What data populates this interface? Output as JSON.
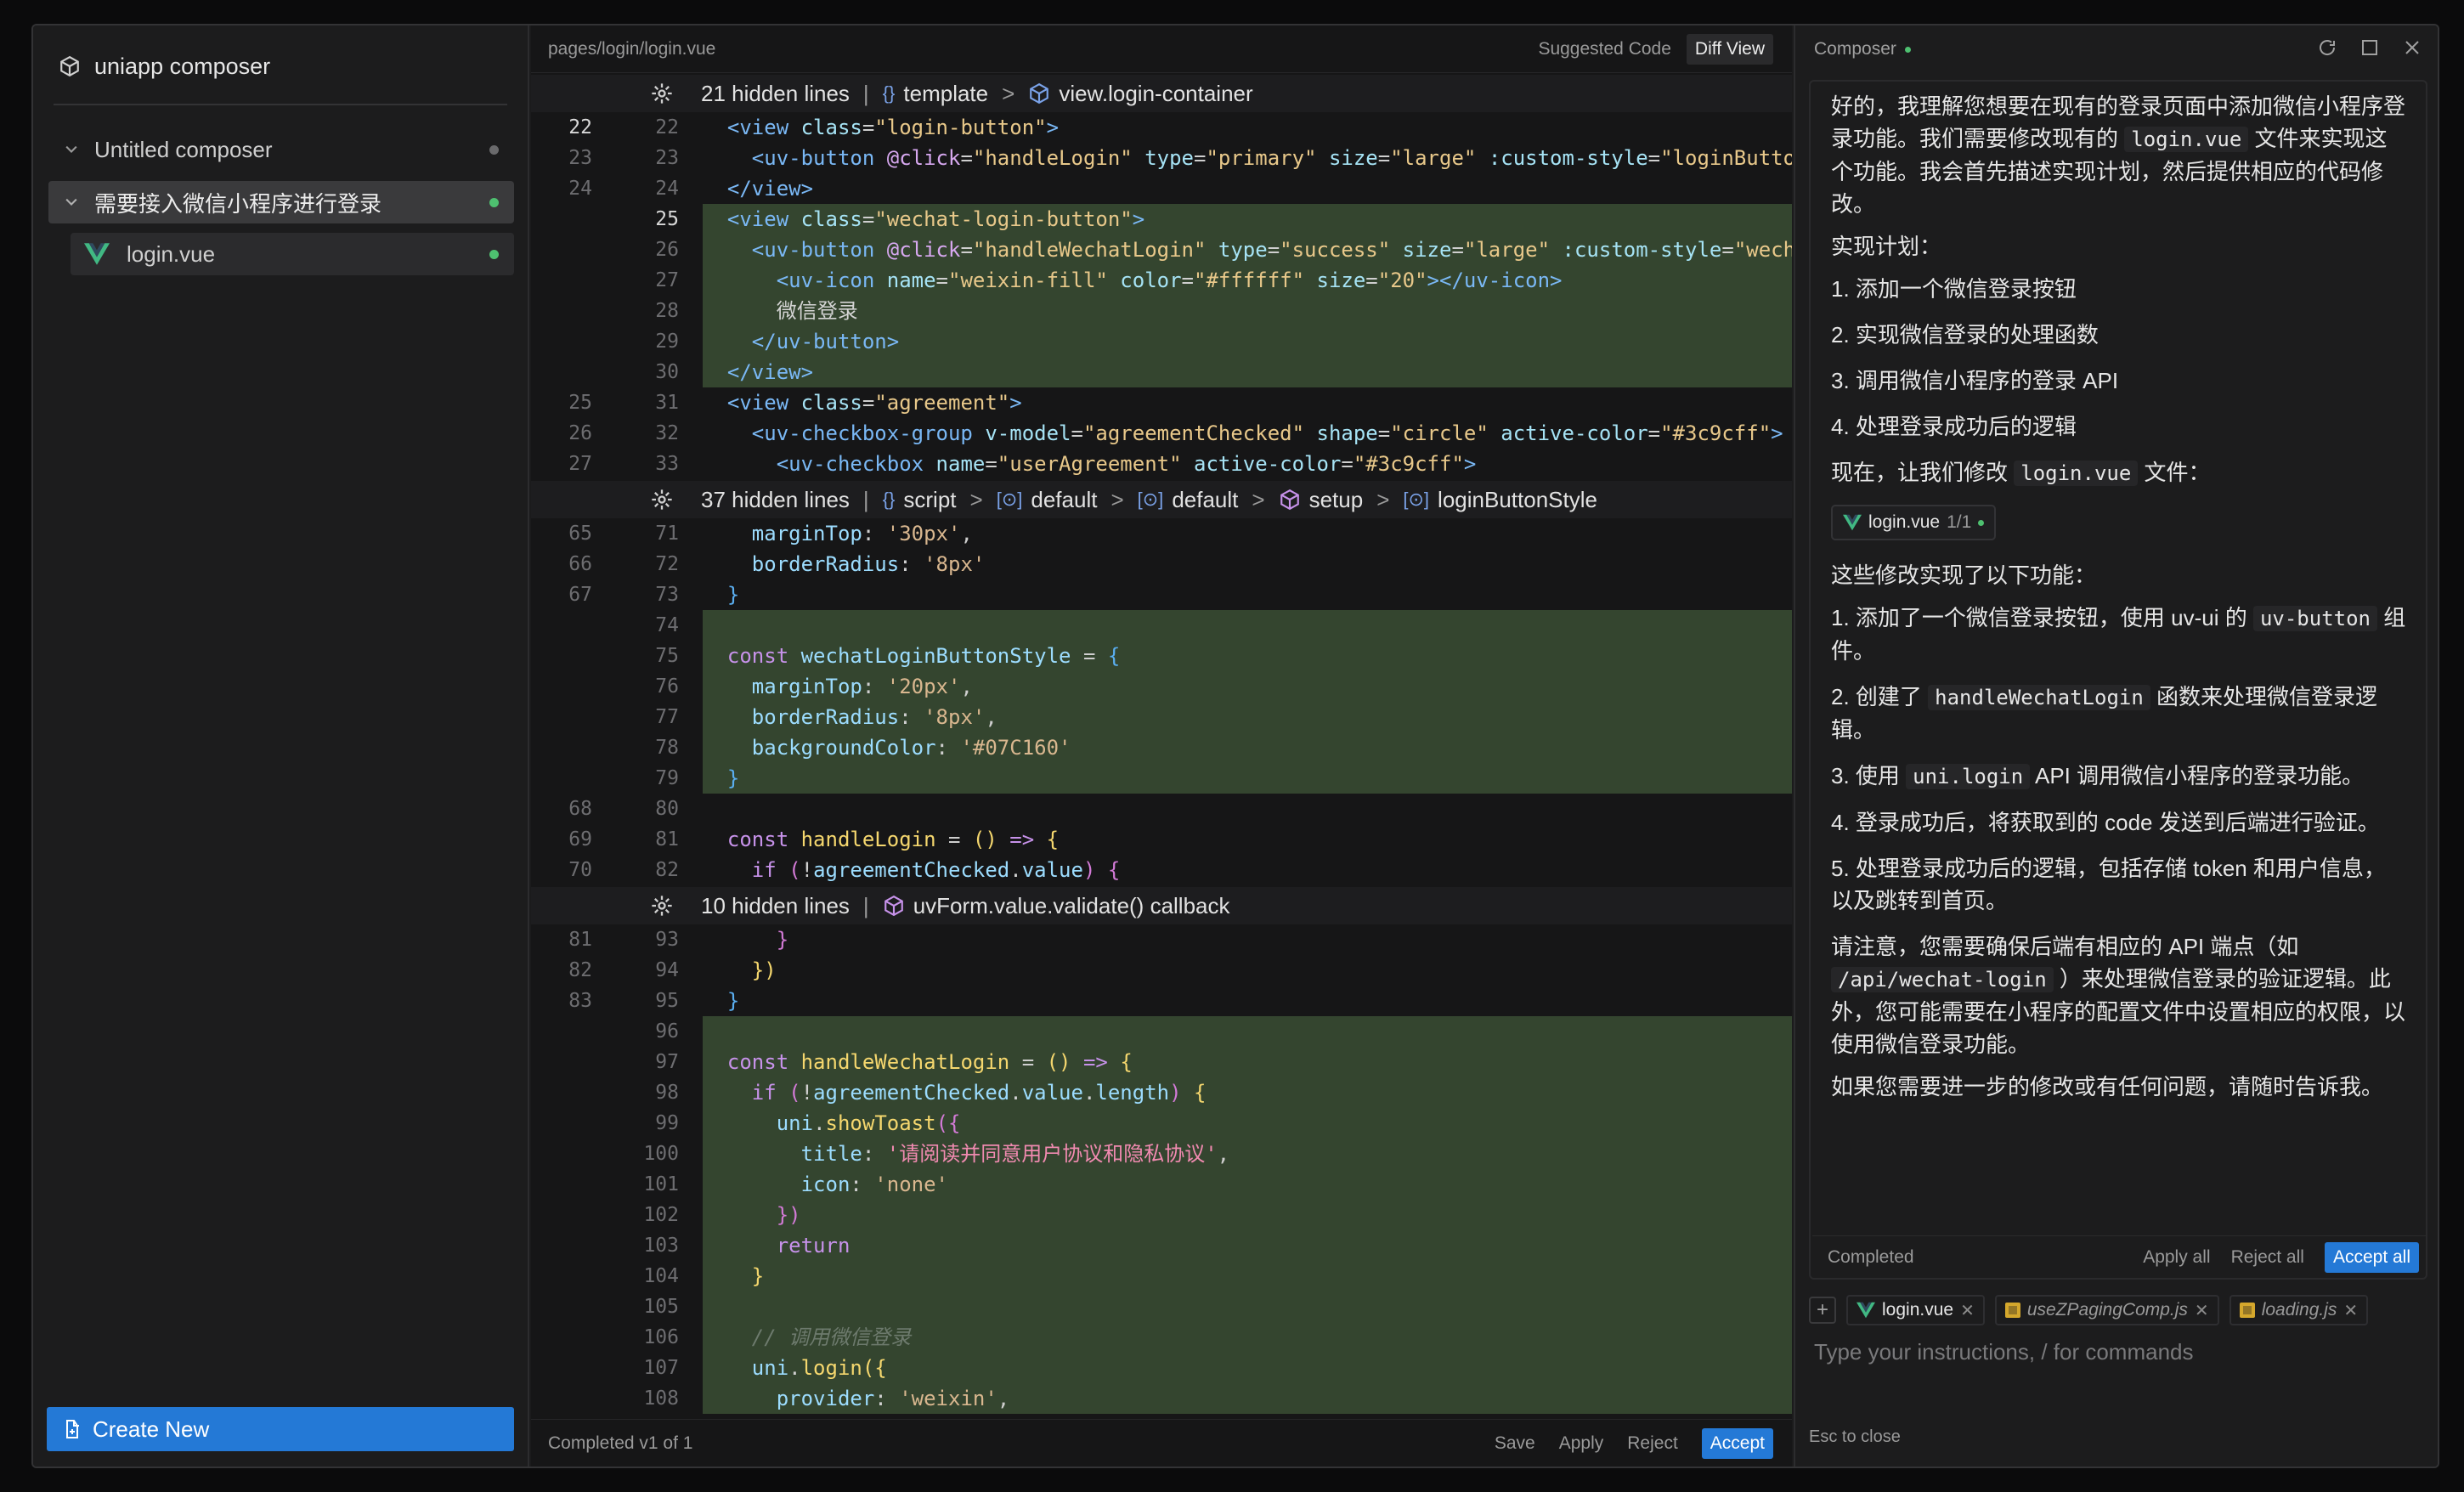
{
  "sidebar": {
    "title": "uniapp composer",
    "items": [
      {
        "label": "Untitled composer"
      },
      {
        "label": "需要接入微信小程序进行登录"
      },
      {
        "label": "login.vue"
      }
    ],
    "create_label": "Create New"
  },
  "editor": {
    "path": "pages/login/login.vue",
    "tab_suggested": "Suggested Code",
    "tab_diff": "Diff View",
    "hidden1": {
      "count": "21 hidden lines",
      "c1": "template",
      "c2": "view.login-container"
    },
    "hidden2": {
      "count": "37 hidden lines",
      "c1": "script",
      "c2": "default",
      "c3": "default",
      "c4": "setup",
      "c5": "loginButtonStyle"
    },
    "hidden3": {
      "count": "10 hidden lines",
      "c1": "uvForm.value.validate() callback"
    },
    "status": "Completed v1 of 1",
    "save": "Save",
    "apply": "Apply",
    "reject": "Reject",
    "accept": "Accept"
  },
  "composer": {
    "title": "Composer",
    "p1a": "好的，我理解您想要在现有的登录页面中添加微信小程序登录功能。我们需要修改现有的",
    "p1code": "login.vue",
    "p1b": "文件来实现这个功能。我会首先描述实现计划，然后提供相应的代码修改。",
    "plan_title": "实现计划：",
    "plan": [
      "1. 添加一个微信登录按钮",
      "2. 实现微信登录的处理函数",
      "3. 调用微信小程序的登录 API",
      "4. 处理登录成功后的逻辑"
    ],
    "p2a": "现在，让我们修改",
    "p2code": "login.vue",
    "p2b": "文件：",
    "chip_file": "login.vue",
    "chip_count": "1/1",
    "features_title": "这些修改实现了以下功能：",
    "f1a": "1. 添加了一个微信登录按钮，使用 uv-ui 的",
    "f1code": "uv-button",
    "f1b": "组件。",
    "f2a": "2. 创建了",
    "f2code": "handleWechatLogin",
    "f2b": "函数来处理微信登录逻辑。",
    "f3a": "3. 使用",
    "f3code": "uni.login",
    "f3b": "API 调用微信小程序的登录功能。",
    "f4": "4. 登录成功后，将获取到的 code 发送到后端进行验证。",
    "f5": "5. 处理登录成功后的逻辑，包括存储 token 和用户信息，以及跳转到首页。",
    "n1a": "请注意，您需要确保后端有相应的 API 端点（如",
    "n1code": "/api/wechat-login",
    "n1b": "）来处理微信登录的验证逻辑。此外，您可能需要在小程序的配置文件中设置相应的权限，以使用微信登录功能。",
    "n2": "如果您需要进一步的修改或有任何问题，请随时告诉我。",
    "status": "Completed",
    "apply_all": "Apply all",
    "reject_all": "Reject all",
    "accept_all": "Accept all",
    "ctx": [
      "login.vue",
      "useZPagingComp.js",
      "loading.js"
    ],
    "placeholder": "Type your instructions, / for commands",
    "esc": "Esc to close"
  }
}
